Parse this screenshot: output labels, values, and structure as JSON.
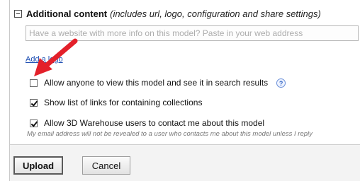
{
  "section": {
    "title": "Additional content",
    "hint": "(includes url, logo, configuration and share settings)"
  },
  "website_input": {
    "value": "",
    "placeholder": "Have a website with more info on this model? Paste in your web address"
  },
  "logo_link": "Add a logo",
  "options": [
    {
      "label": "Allow anyone to view this model and see it in search results",
      "checked": false
    },
    {
      "label": "Show list of links for containing collections",
      "checked": true
    },
    {
      "label": "Allow 3D Warehouse users to contact me about this model",
      "checked": true
    }
  ],
  "help_icon": {
    "glyph": "?"
  },
  "contact_note": "My email address will not be revealed to a user who contacts me about this model unless I reply",
  "buttons": {
    "upload": "Upload",
    "cancel": "Cancel"
  },
  "colors": {
    "link": "#1e4fb3",
    "arrow": "#e3202a"
  }
}
